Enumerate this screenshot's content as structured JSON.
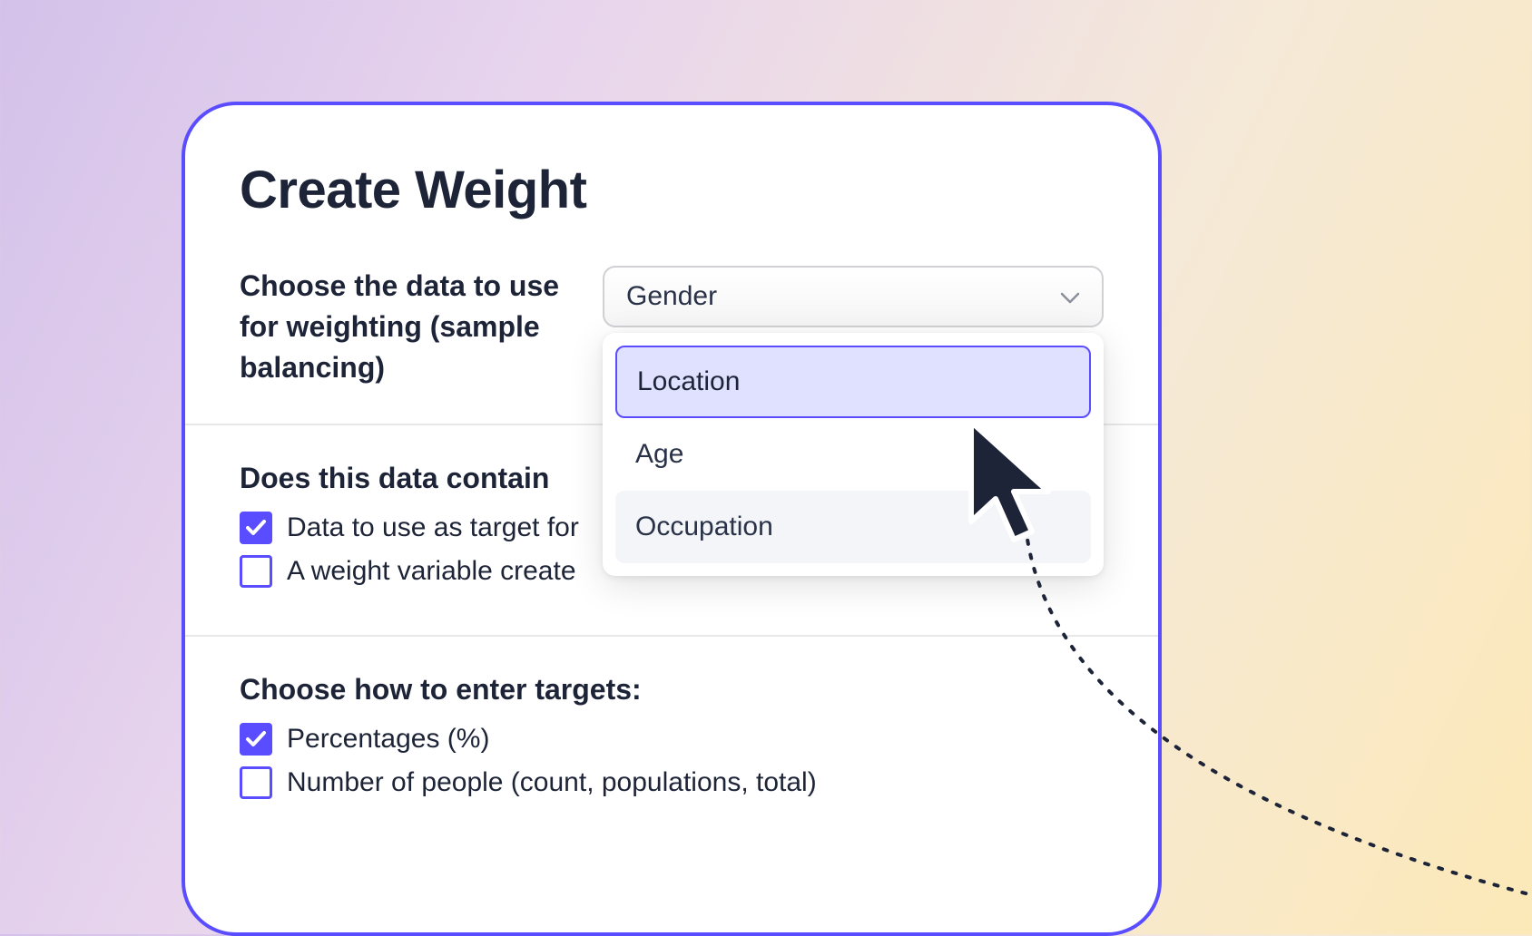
{
  "modal": {
    "title": "Create Weight",
    "section1": {
      "label": "Choose the data to use for weighting (sample balancing)",
      "dropdown": {
        "selected": "Gender",
        "options": [
          {
            "label": "Location",
            "highlighted": true
          },
          {
            "label": "Age",
            "highlighted": false
          },
          {
            "label": "Occupation",
            "highlighted": false
          }
        ]
      }
    },
    "section2": {
      "label": "Does this data contain",
      "checkboxes": [
        {
          "label": "Data to use as target for",
          "checked": true
        },
        {
          "label": "A weight variable create",
          "checked": false
        }
      ]
    },
    "section3": {
      "label": "Choose how to enter targets:",
      "checkboxes": [
        {
          "label": "Percentages (%)",
          "checked": true
        },
        {
          "label": "Number of people (count, populations, total)",
          "checked": false
        }
      ]
    }
  },
  "colors": {
    "accent": "#5a4dff",
    "text": "#1d2437"
  }
}
